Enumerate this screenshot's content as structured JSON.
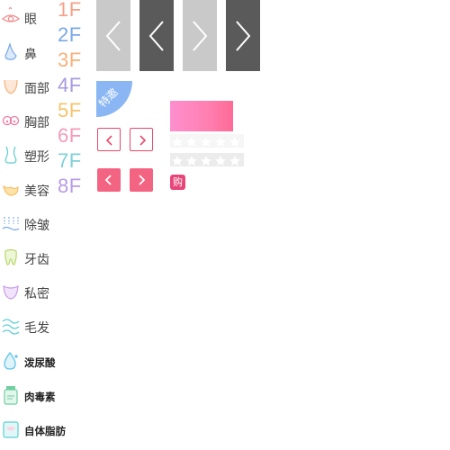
{
  "categories": [
    {
      "label": "眼",
      "icon": "eye-icon",
      "color": "#f28a8a"
    },
    {
      "label": "鼻",
      "icon": "nose-icon",
      "color": "#7aa8e8"
    },
    {
      "label": "面部",
      "icon": "face-icon",
      "color": "#f5b27a"
    },
    {
      "label": "胸部",
      "icon": "chest-icon",
      "color": "#f07aa0"
    },
    {
      "label": "塑形",
      "icon": "body-shape-icon",
      "color": "#68cfd0"
    },
    {
      "label": "美容",
      "icon": "beauty-icon",
      "color": "#f5c06a"
    },
    {
      "label": "除皱",
      "icon": "wrinkle-icon",
      "color": "#7aa8e8"
    },
    {
      "label": "牙齿",
      "icon": "tooth-icon",
      "color": "#b6d86b"
    },
    {
      "label": "私密",
      "icon": "private-icon",
      "color": "#c99ae8"
    },
    {
      "label": "毛发",
      "icon": "hair-icon",
      "color": "#5fcfd6"
    },
    {
      "label": "泼尿酸",
      "icon": "droplet-icon",
      "color": "#5fc4e8"
    },
    {
      "label": "肉毒素",
      "icon": "bottle-icon",
      "color": "#6fcfa0"
    },
    {
      "label": "自体脂肪",
      "icon": "fat-icon",
      "color": "#5fcfd6"
    }
  ],
  "floors": [
    {
      "label": "1F",
      "color": "#f5a08a"
    },
    {
      "label": "2F",
      "color": "#7aa8e8"
    },
    {
      "label": "3F",
      "color": "#f5b27a"
    },
    {
      "label": "4F",
      "color": "#a89ae0"
    },
    {
      "label": "5F",
      "color": "#f5c46a"
    },
    {
      "label": "6F",
      "color": "#f59ab8"
    },
    {
      "label": "7F",
      "color": "#7fd0d8"
    },
    {
      "label": "8F",
      "color": "#b89ae8"
    }
  ],
  "badge": {
    "label": "特邀",
    "color": "#8ab6f3"
  },
  "buy": {
    "label": "购"
  },
  "colors": {
    "accent": "#f26482",
    "tile_light": "#c9c9c9",
    "tile_dark": "#5a5a5a"
  }
}
